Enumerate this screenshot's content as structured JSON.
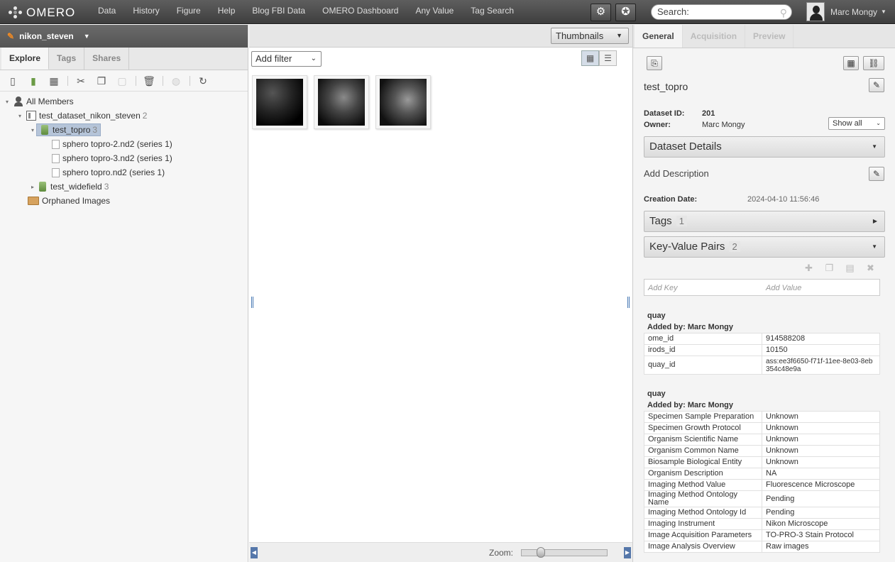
{
  "app": {
    "name": "OMERO"
  },
  "nav": [
    "Data",
    "History",
    "Figure",
    "Help",
    "Blog FBI Data",
    "OMERO Dashboard",
    "Any Value",
    "Tag Search"
  ],
  "search": {
    "placeholder": "Search:"
  },
  "user": {
    "name": "Marc Mongy"
  },
  "left": {
    "group_user": "nikon_steven",
    "tabs": [
      "Explore",
      "Tags",
      "Shares"
    ],
    "tree": {
      "root": "All Members",
      "project": {
        "name": "test_dataset_nikon_steven",
        "count": "2"
      },
      "dataset1": {
        "name": "test_topro",
        "count": "3"
      },
      "images": [
        "sphero topro-2.nd2 (series 1)",
        "sphero topro-3.nd2 (series 1)",
        "sphero topro.nd2 (series 1)"
      ],
      "dataset2": {
        "name": "test_widefield",
        "count": "3"
      },
      "orphaned": "Orphaned Images"
    }
  },
  "center": {
    "view_select": "Thumbnails",
    "filter": "Add filter",
    "zoom_label": "Zoom:",
    "zoom_level": 0.2
  },
  "right": {
    "tabs": [
      "General",
      "Acquisition",
      "Preview"
    ],
    "title": "test_topro",
    "dataset_id_label": "Dataset ID:",
    "dataset_id": "201",
    "owner_label": "Owner:",
    "owner": "Marc Mongy",
    "show_all": "Show all",
    "dataset_details": "Dataset Details",
    "add_description": "Add Description",
    "creation_label": "Creation Date:",
    "creation_date": "2024-04-10 11:56:46",
    "tags": {
      "label": "Tags",
      "count": "1"
    },
    "kvp": {
      "label": "Key-Value Pairs",
      "count": "2"
    },
    "add_key": "Add Key",
    "add_value": "Add Value",
    "block1": {
      "ns": "quay",
      "added_by": "Added by: Marc Mongy",
      "rows": [
        [
          "ome_id",
          "914588208"
        ],
        [
          "irods_id",
          "10150"
        ],
        [
          "quay_id",
          "ass:ee3f6650-f71f-11ee-8e03-8eb354c48e9a"
        ]
      ]
    },
    "block2": {
      "ns": "quay",
      "added_by": "Added by: Marc Mongy",
      "rows": [
        [
          "Specimen Sample Preparation",
          "Unknown"
        ],
        [
          "Specimen Growth Protocol",
          "Unknown"
        ],
        [
          "Organism Scientific Name",
          "Unknown"
        ],
        [
          "Organism Common Name",
          "Unknown"
        ],
        [
          "Biosample Biological Entity",
          "Unknown"
        ],
        [
          "Organism Description",
          "NA"
        ],
        [
          "Imaging Method Value",
          "Fluorescence Microscope"
        ],
        [
          "Imaging Method Ontology Name",
          "Pending"
        ],
        [
          "Imaging Method Ontology Id",
          "Pending"
        ],
        [
          "Imaging Instrument",
          "Nikon Microscope"
        ],
        [
          "Image Acquisition Parameters",
          "TO-PRO-3 Stain Protocol"
        ],
        [
          "Image Analysis Overview",
          "Raw images"
        ]
      ]
    }
  }
}
